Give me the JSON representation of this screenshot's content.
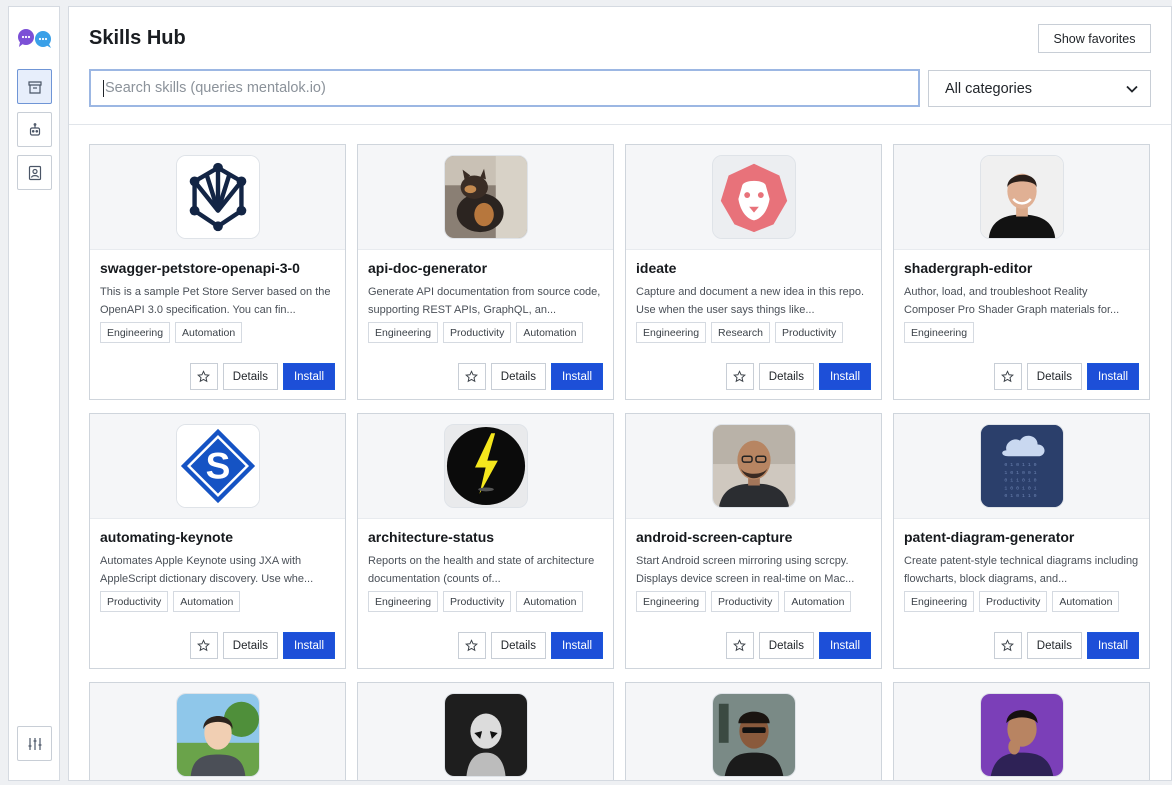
{
  "header": {
    "title": "Skills Hub",
    "favorites_label": "Show favorites",
    "search_placeholder": "Search skills (queries mentalok.io)",
    "category_selected": "All categories"
  },
  "sidebar": {
    "items": [
      {
        "name": "store-icon",
        "active": true
      },
      {
        "name": "robot-icon",
        "active": false
      },
      {
        "name": "contact-card-icon",
        "active": false
      }
    ],
    "bottom": {
      "name": "sliders-icon"
    }
  },
  "card_actions": {
    "details": "Details",
    "install": "Install"
  },
  "skills": [
    {
      "name": "swagger-petstore-openapi-3-0",
      "description": "This is a sample Pet Store Server based on the OpenAPI 3.0 specification. You can fin...",
      "tags": [
        "Engineering",
        "Automation"
      ],
      "icon": "network-shield-icon"
    },
    {
      "name": "api-doc-generator",
      "description": "Generate API documentation from source code, supporting REST APIs, GraphQL, an...",
      "tags": [
        "Engineering",
        "Productivity",
        "Automation"
      ],
      "icon": "cat-photo"
    },
    {
      "name": "ideate",
      "description": "Capture and document a new idea in this repo. Use when the user says things like...",
      "tags": [
        "Engineering",
        "Research",
        "Productivity"
      ],
      "icon": "lion-icon"
    },
    {
      "name": "shadergraph-editor",
      "description": "Author, load, and troubleshoot Reality Composer Pro Shader Graph materials for...",
      "tags": [
        "Engineering"
      ],
      "icon": "person-photo"
    },
    {
      "name": "automating-keynote",
      "description": "Automates Apple Keynote using JXA with AppleScript dictionary discovery. Use whe...",
      "tags": [
        "Productivity",
        "Automation"
      ],
      "icon": "s-diamond-icon"
    },
    {
      "name": "architecture-status",
      "description": "Reports on the health and state of architecture documentation (counts of...",
      "tags": [
        "Engineering",
        "Productivity",
        "Automation"
      ],
      "icon": "lightning-icon"
    },
    {
      "name": "android-screen-capture",
      "description": "Start Android screen mirroring using scrcpy. Displays device screen in real-time on Mac...",
      "tags": [
        "Engineering",
        "Productivity",
        "Automation"
      ],
      "icon": "person-photo"
    },
    {
      "name": "patent-diagram-generator",
      "description": "Create patent-style technical diagrams including flowcharts, block diagrams, and...",
      "tags": [
        "Engineering",
        "Productivity",
        "Automation"
      ],
      "icon": "cloud-rain-icon"
    }
  ],
  "partial_row": [
    {
      "icon": "anime-person-photo"
    },
    {
      "icon": "stormtrooper-photo"
    },
    {
      "icon": "person-photo"
    },
    {
      "icon": "person-photo"
    }
  ],
  "colors": {
    "primary": "#1d4fd8",
    "search_focus": "#9cb7e3",
    "card_top": "#f5f6f8",
    "lion": "#e8727a",
    "keynote": "#1553c4"
  }
}
